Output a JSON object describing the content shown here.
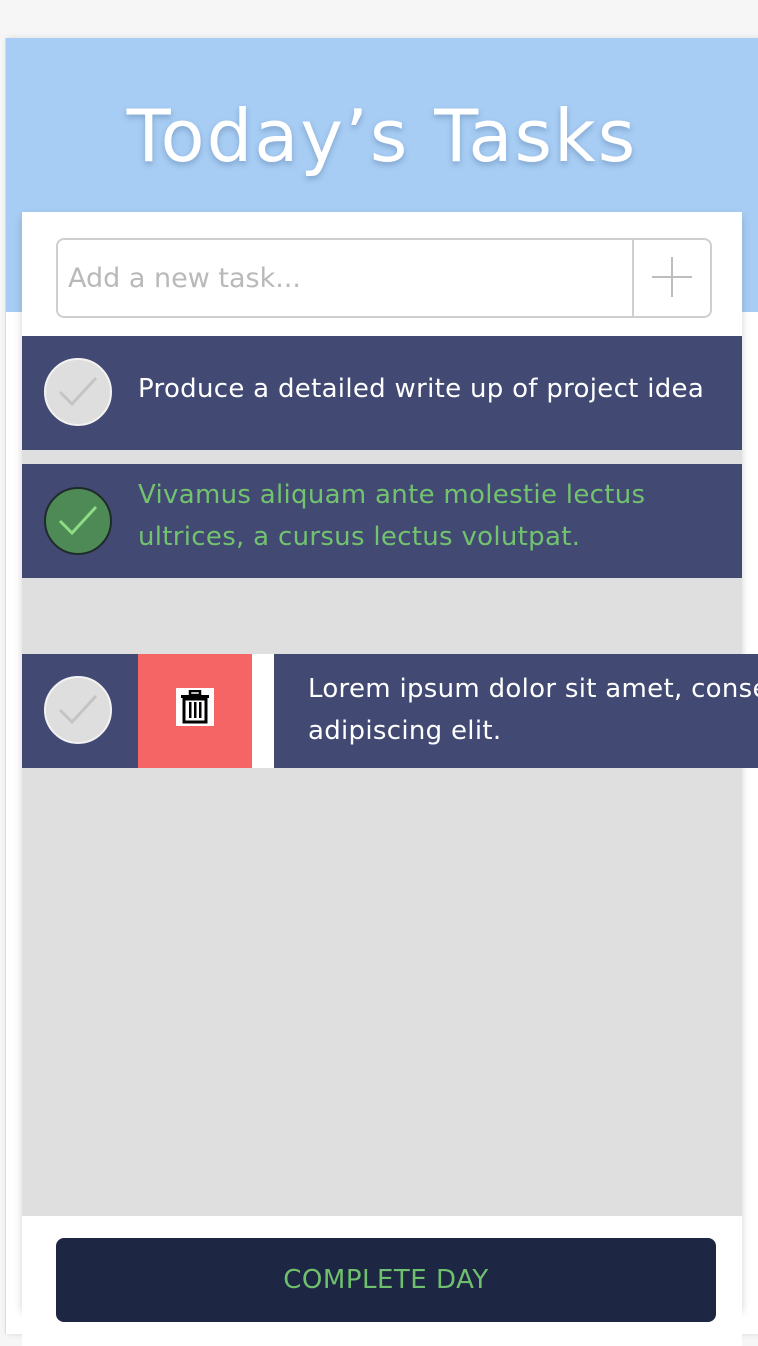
{
  "header": {
    "title": "Today’s Tasks"
  },
  "new_task": {
    "placeholder": "Add a new task..."
  },
  "tasks": [
    {
      "text": "Produce a detailed write up of project idea",
      "completed": false
    },
    {
      "text": "Vivamus aliquam ante molestie lectus ultrices, a cursus lectus volutpat.",
      "completed": true
    },
    {
      "text": "Lorem ipsum dolor sit amet, consectetur adipiscing elit.",
      "completed": false,
      "swiped_open": true
    }
  ],
  "footer": {
    "complete_label": "COMPLETE DAY"
  },
  "colors": {
    "header": "#a7cdf4",
    "task_row": "#424a74",
    "completed_text": "#72c26e",
    "delete": "#f56565",
    "primary_button": "#1d2643"
  },
  "icons": {
    "add": "plus-icon",
    "check": "check-icon",
    "delete": "trash-icon"
  }
}
